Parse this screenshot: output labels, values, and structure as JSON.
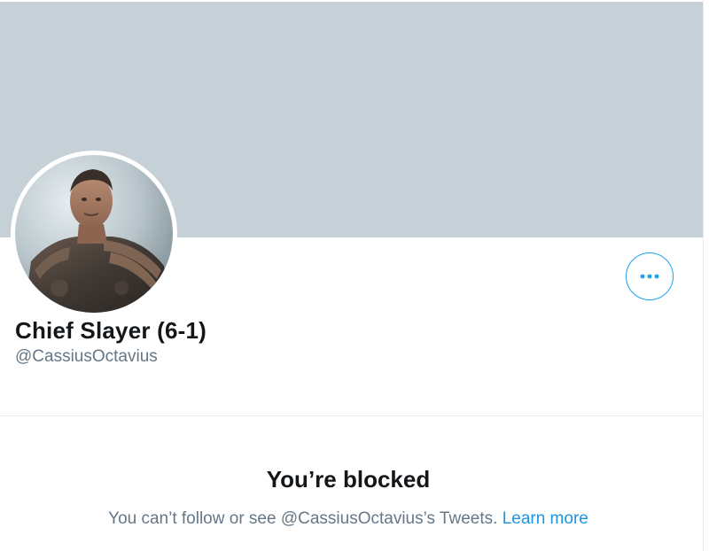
{
  "profile": {
    "display_name": "Chief Slayer (6-1)",
    "handle": "@CassiusOctavius",
    "avatar_alt": "avatar",
    "more_icon": "more-horizontal-icon"
  },
  "blocked": {
    "title": "You’re blocked",
    "message_prefix": "You can’t follow or see @CassiusOctavius’s Tweets.",
    "learn_more": "Learn more"
  },
  "colors": {
    "banner": "#c6d0d7",
    "accent": "#1da1f2",
    "text_primary": "#14171a",
    "text_secondary": "#657786",
    "link": "#1b95e0"
  }
}
